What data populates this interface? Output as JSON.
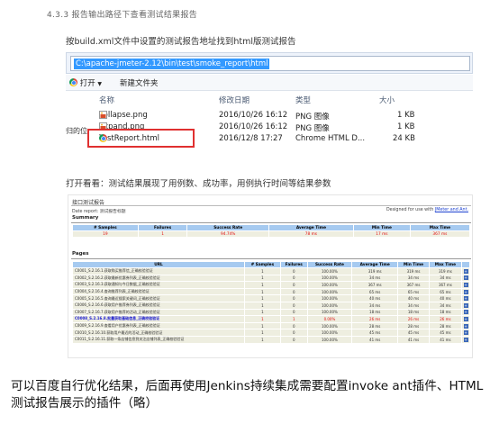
{
  "section": {
    "title": "4.3.3 报告输出路径下查看测试结果报告"
  },
  "caption1": "按build.xml文件中设置的测试报告地址找到html版测试报告",
  "explorer": {
    "address": "C:\\apache-jmeter-2.12\\bin\\test\\smoke_report\\html",
    "toolbar": {
      "open_label": "打开",
      "new_folder_label": "新建文件夹"
    },
    "columns": {
      "name": "名称",
      "modified": "修改日期",
      "type": "类型",
      "size": "大小"
    },
    "left_fragment": "归的位",
    "files": [
      {
        "name": "collapse.png",
        "modified": "2016/10/26 16:12",
        "type": "PNG 图像",
        "size": "1 KB",
        "icon": "png-icon"
      },
      {
        "name": "expand.png",
        "modified": "2016/10/26 16:12",
        "type": "PNG 图像",
        "size": "1 KB",
        "icon": "png-icon"
      },
      {
        "name": "TestReport.html",
        "modified": "2016/12/8 17:27",
        "type": "Chrome HTML D...",
        "size": "24 KB",
        "icon": "chrome-html-icon"
      }
    ]
  },
  "caption2": "打开看看：测试结果展现了用例数、成功率，用例执行时间等结果参数",
  "report": {
    "title": "接口测试报告",
    "date_label": "Date report: 测试报告标题",
    "designed_prefix": "Designed for use with ",
    "designed_links": "JMeter and Ant.",
    "summary_heading": "Summary",
    "summary_headers": [
      "# Samples",
      "Failures",
      "Success Rate",
      "Average Time",
      "Min Time",
      "Max Time"
    ],
    "summary_values": [
      "19",
      "1",
      "94.74%",
      "78 ms",
      "17 ms",
      "367 ms"
    ],
    "pages_heading": "Pages",
    "pages_headers": [
      "URL",
      "# Samples",
      "Failures",
      "Success Rate",
      "Average Time",
      "Min Time",
      "Max Time",
      ""
    ],
    "rows": [
      {
        "url": "C0001_S.2.16.1.获取购买推荐信_正确校验验证",
        "samples": "1",
        "failures": "0",
        "rate": "100.00%",
        "avg": "319 ms",
        "min": "319 ms",
        "max": "319 ms",
        "fail": false
      },
      {
        "url": "C0002_S.2.16.2.获取最新优惠券列表_正确校验验证",
        "samples": "1",
        "failures": "0",
        "rate": "100.00%",
        "avg": "34 ms",
        "min": "34 ms",
        "max": "34 ms",
        "fail": false
      },
      {
        "url": "C0003_S.2.16.3.获取通知与今日数据_正确校验验证",
        "samples": "1",
        "failures": "0",
        "rate": "100.00%",
        "avg": "367 ms",
        "min": "367 ms",
        "max": "367 ms",
        "fail": false
      },
      {
        "url": "C0004_S.2.16.4.查询推荐列表_正确校验验证",
        "samples": "1",
        "failures": "0",
        "rate": "100.00%",
        "avg": "65 ms",
        "min": "65 ms",
        "max": "65 ms",
        "fail": false
      },
      {
        "url": "C0005_S.2.16.5.查询最近搜索关键词_正确校验验证",
        "samples": "1",
        "failures": "0",
        "rate": "100.00%",
        "avg": "40 ms",
        "min": "40 ms",
        "max": "40 ms",
        "fail": false
      },
      {
        "url": "C0006_S.2.16.6.获取用户推荐券列表_正确校验验证",
        "samples": "1",
        "failures": "0",
        "rate": "100.00%",
        "avg": "34 ms",
        "min": "34 ms",
        "max": "34 ms",
        "fail": false
      },
      {
        "url": "C0007_S.2.16.7.获取用户推荐的活动_正确校验验证",
        "samples": "1",
        "failures": "0",
        "rate": "100.00%",
        "avg": "18 ms",
        "min": "18 ms",
        "max": "18 ms",
        "fail": false
      },
      {
        "url": "C0008_S.2.16.8.批量获取基础信息_正确校验验证",
        "samples": "1",
        "failures": "1",
        "rate": "0.00%",
        "avg": "26 ms",
        "min": "26 ms",
        "max": "26 ms",
        "fail": true
      },
      {
        "url": "C0009_S.2.16.9.查看用户优惠券列表_正确校验验证",
        "samples": "1",
        "failures": "0",
        "rate": "100.00%",
        "avg": "28 ms",
        "min": "28 ms",
        "max": "28 ms",
        "fail": false
      },
      {
        "url": "C0010_S.2.16.10.获取用户最近的活动_正确校验验证",
        "samples": "1",
        "failures": "0",
        "rate": "100.00%",
        "avg": "45 ms",
        "min": "45 ms",
        "max": "45 ms",
        "fail": false
      },
      {
        "url": "C0011_S.2.16.11.获取一条店铺信息到关注店铺列表_正确校验验证",
        "samples": "1",
        "failures": "0",
        "rate": "100.00%",
        "avg": "41 ms",
        "min": "41 ms",
        "max": "41 ms",
        "fail": false
      }
    ],
    "expand_glyph": "+"
  },
  "footer_text": "可以百度自行优化结果，后面再使用Jenkins持续集成需要配置invoke ant插件、HTML测试报告展示的插件（略）"
}
